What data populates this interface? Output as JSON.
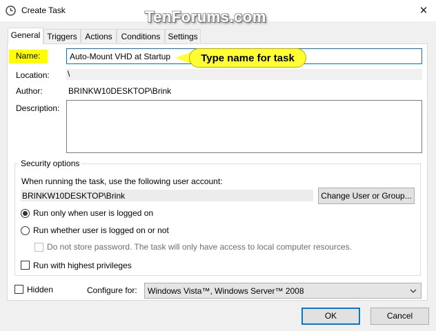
{
  "window": {
    "title": "Create Task",
    "watermark": "TenForums.com",
    "close_glyph": "✕"
  },
  "tabs": [
    {
      "label": "General",
      "active": true
    },
    {
      "label": "Triggers",
      "active": false
    },
    {
      "label": "Actions",
      "active": false
    },
    {
      "label": "Conditions",
      "active": false
    },
    {
      "label": "Settings",
      "active": false
    }
  ],
  "general": {
    "name_label": "Name:",
    "name_value": "Auto-Mount VHD at Startup",
    "callout": "Type name for task",
    "location_label": "Location:",
    "location_value": "\\",
    "author_label": "Author:",
    "author_value": "BRINKW10DESKTOP\\Brink",
    "description_label": "Description:",
    "description_value": ""
  },
  "security": {
    "legend": "Security options",
    "account_prompt": "When running the task, use the following user account:",
    "account_value": "BRINKW10DESKTOP\\Brink",
    "change_button": "Change User or Group...",
    "radio_logged_on": "Run only when user is logged on",
    "radio_whether": "Run whether user is logged on or not",
    "radio_selected": "logged_on",
    "no_store_password": "Do not store password.  The task will only have access to local computer resources.",
    "highest_privileges": "Run with highest privileges"
  },
  "footer": {
    "hidden_label": "Hidden",
    "configure_label": "Configure for:",
    "configure_value": "Windows Vista™, Windows Server™ 2008",
    "ok_label": "OK",
    "cancel_label": "Cancel"
  },
  "colors": {
    "highlight": "#ffff00",
    "callout": "#ffff33",
    "default_button_border": "#0078d7"
  }
}
